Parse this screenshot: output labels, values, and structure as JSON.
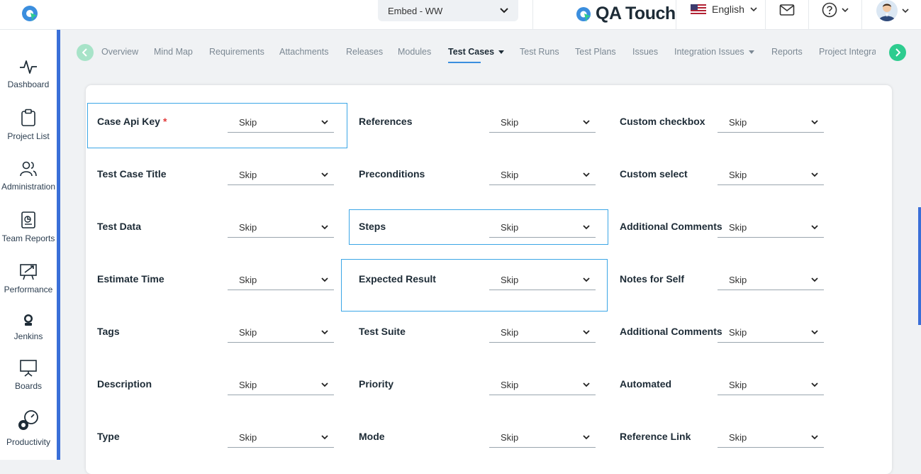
{
  "topbar": {
    "project_select": "Embed - WW",
    "brand_name": "QA Touch",
    "language": "English"
  },
  "sidebar": {
    "items": [
      {
        "label": "Dashboard"
      },
      {
        "label": "Project List"
      },
      {
        "label": "Administration"
      },
      {
        "label": "Team Reports"
      },
      {
        "label": "Performance"
      },
      {
        "label": "Jenkins"
      },
      {
        "label": "Boards"
      },
      {
        "label": "Productivity"
      }
    ]
  },
  "tabs": [
    {
      "label": "Overview"
    },
    {
      "label": "Mind Map"
    },
    {
      "label": "Requirements"
    },
    {
      "label": "Attachments"
    },
    {
      "label": "Releases"
    },
    {
      "label": "Modules"
    },
    {
      "label": "Test Cases"
    },
    {
      "label": "Test Runs"
    },
    {
      "label": "Test Plans"
    },
    {
      "label": "Issues"
    },
    {
      "label": "Integration Issues"
    },
    {
      "label": "Reports"
    },
    {
      "label": "Project Integrat"
    }
  ],
  "fields": {
    "col1": [
      {
        "label": "Case Api Key",
        "value": "Skip",
        "required": "*"
      },
      {
        "label": "Test Case Title",
        "value": "Skip"
      },
      {
        "label": "Test Data",
        "value": "Skip"
      },
      {
        "label": "Estimate Time",
        "value": "Skip"
      },
      {
        "label": "Tags",
        "value": "Skip"
      },
      {
        "label": "Description",
        "value": "Skip"
      },
      {
        "label": "Type",
        "value": "Skip"
      }
    ],
    "col2": [
      {
        "label": "References",
        "value": "Skip"
      },
      {
        "label": "Preconditions",
        "value": "Skip"
      },
      {
        "label": "Steps",
        "value": "Skip"
      },
      {
        "label": "Expected Result",
        "value": "Skip"
      },
      {
        "label": "Test Suite",
        "value": "Skip"
      },
      {
        "label": "Priority",
        "value": "Skip"
      },
      {
        "label": "Mode",
        "value": "Skip"
      }
    ],
    "col3": [
      {
        "label": "Custom checkbox",
        "value": "Skip"
      },
      {
        "label": "Custom select",
        "value": "Skip"
      },
      {
        "label": "Additional Comments",
        "value": "Skip"
      },
      {
        "label": "Notes for Self",
        "value": "Skip"
      },
      {
        "label": "Additional Comments",
        "value": "Skip"
      },
      {
        "label": "Automated",
        "value": "Skip"
      },
      {
        "label": "Reference Link",
        "value": "Skip"
      }
    ]
  },
  "colors": {
    "accent": "#3a6fd8",
    "highlight": "#3ba6e6",
    "tab_arrow": "#2ecc8f",
    "required": "#e23b3b"
  }
}
